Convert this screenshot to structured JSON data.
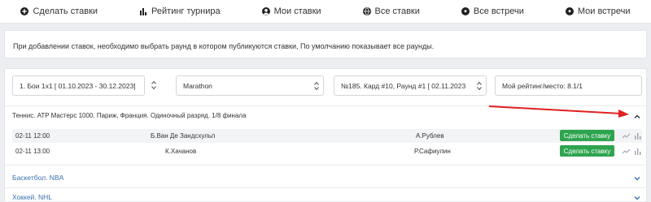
{
  "nav": [
    {
      "label": "Сделать ставки",
      "icon": "plus-circle-icon"
    },
    {
      "label": "Рейтинг турнира",
      "icon": "bar-chart-icon"
    },
    {
      "label": "Мои ставки",
      "icon": "user-circle-icon"
    },
    {
      "label": "Все ставки",
      "icon": "globe-icon"
    },
    {
      "label": "Все встречи",
      "icon": "soccer-ball-icon"
    },
    {
      "label": "Мои встречи",
      "icon": "soccer-ball-icon"
    }
  ],
  "notice": "При добавлении ставок, необходимо выбрать раунд в котором публикуются ставки, По умолчанию показывает все раунды.",
  "filters": {
    "round_select": "1. Бои 1х1   [ 01.10.2023 - 30.12.2023]",
    "bookmaker_select": "Marathon",
    "card_select": "№185. Кард #10, Раунд #1   [ 02.11.2023",
    "rating": "Мой рейтинг/место: 8.1/1"
  },
  "tennis": {
    "title": "Теннис. ATP Мастерс 1000. Париж, Франция. Одиночный разряд. 1/8 финала",
    "matches": [
      {
        "time": "02-11 12:00",
        "player1": "Б.Ван Де Зандсхульп",
        "player2": "А.Рублев",
        "button": "Сделать ставку"
      },
      {
        "time": "02-11 13:00",
        "player1": "К.Хачанов",
        "player2": "Р.Сафиулин",
        "button": "Сделать ставку"
      }
    ]
  },
  "basketball": {
    "title": "Баскетбол. NBA"
  },
  "hockey": {
    "title": "Хоккей. NHL"
  },
  "colors": {
    "accent_green": "#2ea44f",
    "link_blue": "#3a6fb0",
    "annotation_red": "#e02020"
  }
}
